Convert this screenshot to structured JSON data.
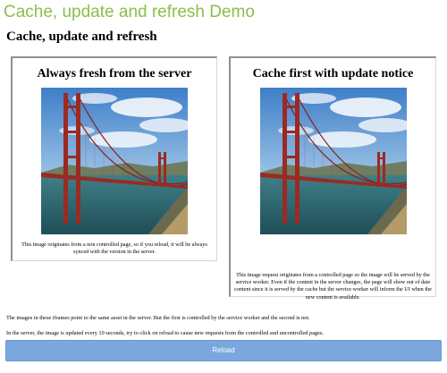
{
  "app": {
    "title": "Cache, update and refresh Demo"
  },
  "page": {
    "heading": "Cache, update and refresh"
  },
  "frames": [
    {
      "title": "Always fresh from the server",
      "image": "golden-gate-bridge-photo",
      "caption": "This image originates from a non controlled page, so if you reload, it will be always synced with the version in the server."
    },
    {
      "title": "Cache first with update notice",
      "image": "golden-gate-bridge-photo",
      "caption": "This image request originates from a controlled page so the image will be served by the service worker. Even if the content in the server changes, the page will show out of date content since it is served by the cache but the service worker will inform the UI when the new content is available."
    }
  ],
  "notes": [
    "The images in these iframes point to the same asset in the server. But the first is controlled by the service worker and the second is not.",
    "In the server, the image is updated every 10 seconds, try to click on reload to cause new requests from the controlled and uncontrolled pages."
  ],
  "reload_button": {
    "label": "Reload"
  },
  "colors": {
    "title": "#8bbf4a",
    "button": "#7ba7df",
    "button_text": "#ffffff"
  }
}
